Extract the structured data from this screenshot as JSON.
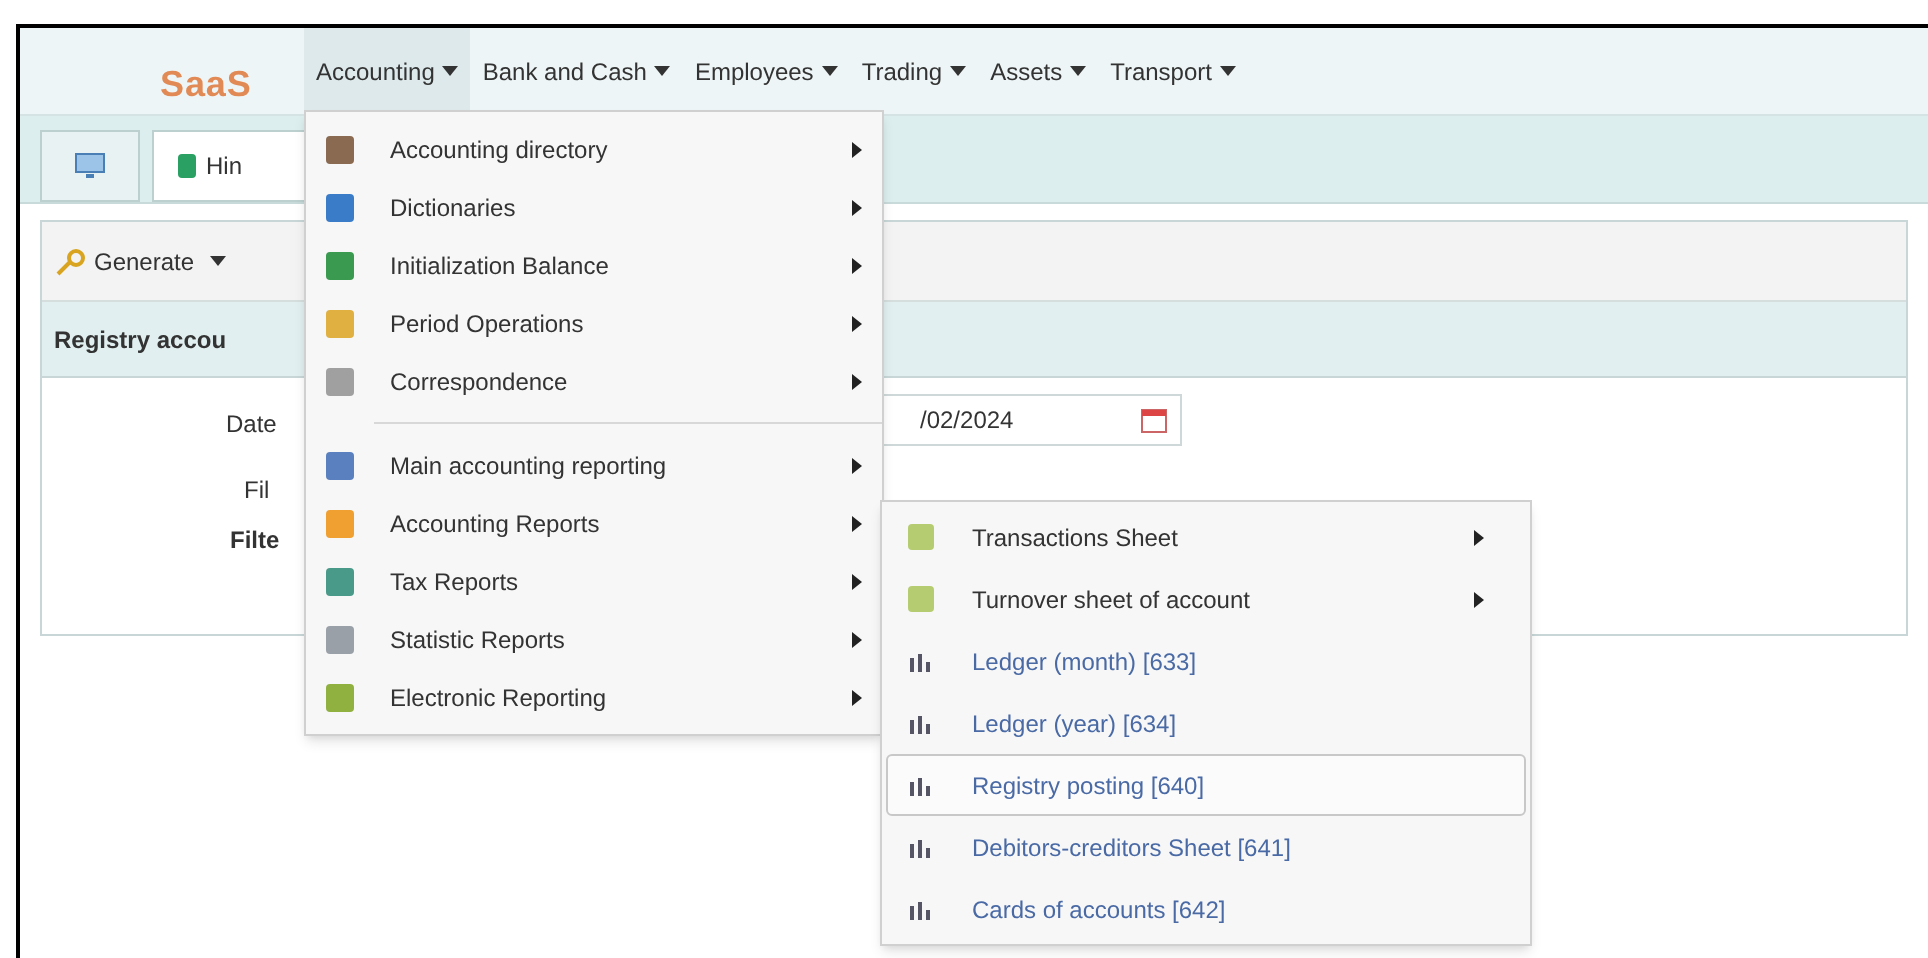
{
  "logo": {
    "text": "SaaS"
  },
  "menubar": [
    {
      "label": "Accounting",
      "selected": true
    },
    {
      "label": "Bank and Cash",
      "selected": false
    },
    {
      "label": "Employees",
      "selected": false
    },
    {
      "label": "Trading",
      "selected": false
    },
    {
      "label": "Assets",
      "selected": false
    },
    {
      "label": "Transport",
      "selected": false
    }
  ],
  "tabs": [
    {
      "kind": "icon"
    },
    {
      "kind": "text",
      "label": "Hin"
    }
  ],
  "toolbar": {
    "generate": "Generate"
  },
  "panel": {
    "title": "Registry accou",
    "date_label": "Date",
    "date_value": "/02/2024",
    "filter_labels": [
      "Fil",
      "Filte"
    ]
  },
  "menu": [
    {
      "items": [
        {
          "label": "Accounting directory"
        },
        {
          "label": "Dictionaries"
        },
        {
          "label": "Initialization Balance"
        },
        {
          "label": "Period Operations"
        },
        {
          "label": "Correspondence"
        }
      ]
    },
    {
      "items": [
        {
          "label": "Main accounting reporting"
        },
        {
          "label": "Accounting Reports"
        },
        {
          "label": "Tax Reports"
        },
        {
          "label": "Statistic Reports"
        },
        {
          "label": "Electronic Reporting"
        }
      ]
    }
  ],
  "submenu": [
    {
      "label": "Transactions Sheet",
      "kind": "submenu",
      "selected": false
    },
    {
      "label": "Turnover sheet of account",
      "kind": "submenu",
      "selected": false
    },
    {
      "label": "Ledger (month) [633]",
      "kind": "report",
      "selected": false
    },
    {
      "label": "Ledger (year) [634]",
      "kind": "report",
      "selected": false
    },
    {
      "label": "Registry posting [640]",
      "kind": "report",
      "selected": true
    },
    {
      "label": "Debitors-creditors Sheet [641]",
      "kind": "report",
      "selected": false
    },
    {
      "label": "Cards of accounts [642]",
      "kind": "report",
      "selected": false
    }
  ]
}
